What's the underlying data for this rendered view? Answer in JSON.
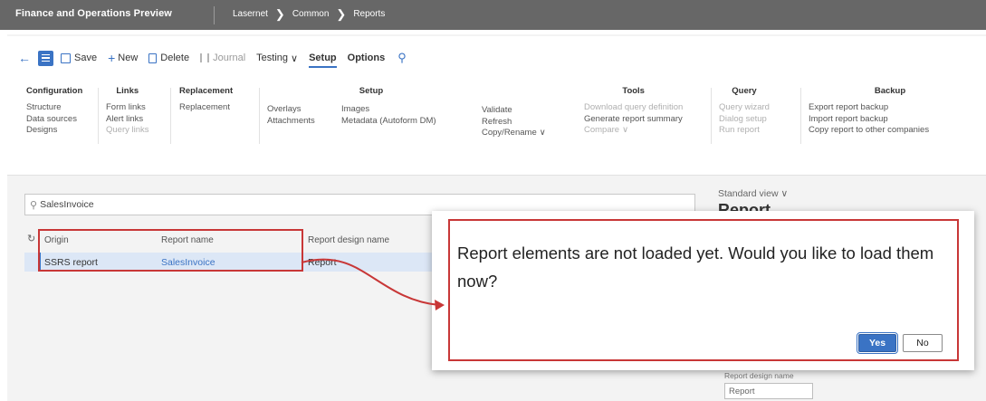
{
  "app": {
    "title": "Finance and Operations Preview",
    "breadcrumb": [
      "Lasernet",
      "Common",
      "Reports"
    ],
    "breadcrumb_separator": "❯"
  },
  "toolbar": {
    "save": "Save",
    "new": "New",
    "delete": "Delete",
    "journal": "Journal",
    "testing": "Testing",
    "setup": "Setup",
    "options": "Options"
  },
  "groups": {
    "configuration": {
      "title": "Configuration",
      "items": [
        "Structure",
        "Data sources",
        "Designs"
      ]
    },
    "links": {
      "title": "Links",
      "items": [
        "Form links",
        "Alert links",
        "Query links"
      ]
    },
    "replacement": {
      "title": "Replacement",
      "items": [
        "Replacement"
      ]
    },
    "setup": {
      "title": "Setup",
      "col1": [
        "Overlays",
        "Attachments"
      ],
      "col2": [
        "Images",
        "Metadata (Autoform DM)"
      ]
    },
    "validate": {
      "items": [
        "Validate",
        "Refresh",
        "Copy/Rename"
      ]
    },
    "tools": {
      "title": "Tools",
      "items": [
        "Download query definition",
        "Generate report summary",
        "Compare"
      ]
    },
    "query": {
      "title": "Query",
      "items": [
        "Query wizard",
        "Dialog setup",
        "Run report"
      ]
    },
    "backup": {
      "title": "Backup",
      "items": [
        "Export report backup",
        "Import report backup",
        "Copy report to other companies"
      ]
    }
  },
  "filter": {
    "value": "SalesInvoice"
  },
  "grid": {
    "headers": {
      "origin": "Origin",
      "name": "Report name",
      "design": "Report design name"
    },
    "rows": [
      {
        "origin": "SSRS report",
        "name": "SalesInvoice",
        "design": "Report"
      }
    ]
  },
  "right_panel": {
    "view": "Standard view",
    "title": "Report",
    "label": "Report design name",
    "value": "Report"
  },
  "dialog": {
    "message": "Report elements are not loaded yet. Would you like to load them now?",
    "yes": "Yes",
    "no": "No"
  },
  "colors": {
    "accent": "#3a73c4",
    "highlight": "#c83737",
    "topbar": "#676767"
  },
  "icons": [
    "back-arrow-icon",
    "menu-icon",
    "save-icon",
    "plus-icon",
    "delete-icon",
    "journal-icon",
    "chevron-down-icon",
    "search-icon",
    "refresh-icon"
  ]
}
